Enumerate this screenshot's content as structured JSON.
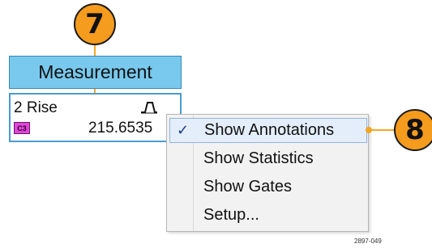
{
  "callouts": {
    "seven": "7",
    "eight": "8"
  },
  "measurement": {
    "title": "Measurement",
    "badge": {
      "name": "2 Rise",
      "source": "C3",
      "value": "215.6535",
      "icon": "rise-waveform-icon"
    }
  },
  "context_menu": {
    "items": [
      {
        "label": "Show Annotations",
        "checked": true,
        "highlighted": true
      },
      {
        "label": "Show Statistics",
        "checked": false
      },
      {
        "label": "Show Gates",
        "checked": false
      },
      {
        "label": "Setup...",
        "checked": false
      }
    ],
    "check_glyph": "✓"
  },
  "figure_id": "2897-049",
  "colors": {
    "callout": "#f59b1e",
    "title_bar": "#79c9ee",
    "badge_border": "#4a9bd3",
    "source_badge": "#e046d8",
    "menu_highlight": "#e4eefb"
  }
}
